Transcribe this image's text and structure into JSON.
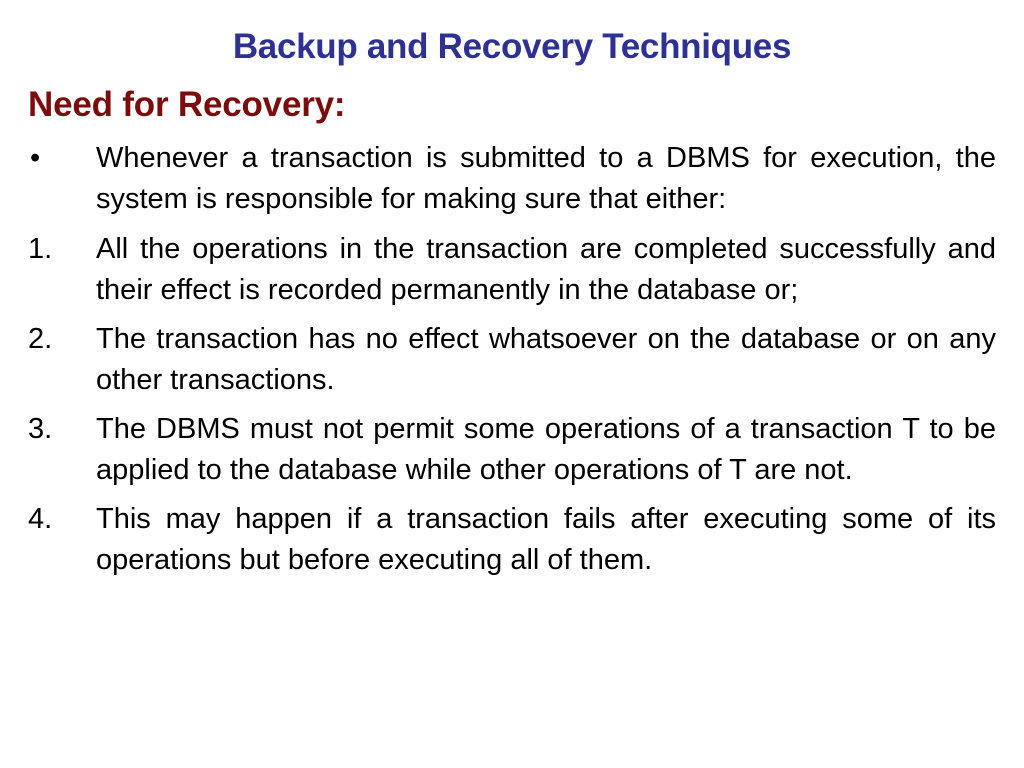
{
  "slide": {
    "title": "Backup and Recovery Techniques",
    "heading": "Need for Recovery:",
    "colors": {
      "title": "#2e3192",
      "heading": "#7b0c0c",
      "body": "#000000"
    },
    "intro": {
      "marker": "•",
      "text": "Whenever a transaction is submitted to a DBMS for execution, the system is responsible for making sure that either:"
    },
    "items": [
      {
        "marker": "1.",
        "text": "All the operations in the transaction are completed successfully and their effect is recorded permanently in the database or;"
      },
      {
        "marker": "2.",
        "text": "The transaction has no effect whatsoever on the database or on any other transactions."
      },
      {
        "marker": "3.",
        "text": "The DBMS must not permit some operations of a transaction T to be applied to the database while other operations of T are not."
      },
      {
        "marker": "4.",
        "text": "This may happen if a transaction fails after executing some of its operations but before executing all of them."
      }
    ]
  }
}
